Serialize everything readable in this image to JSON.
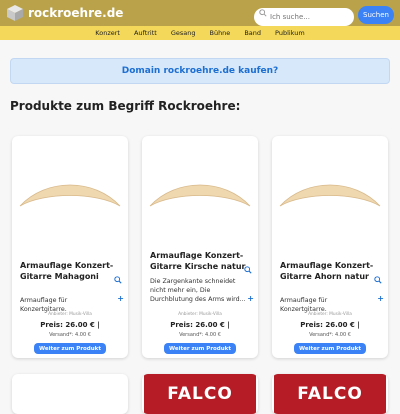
{
  "site": {
    "name": "rockroehre.de"
  },
  "search": {
    "placeholder": "Ich suche...",
    "button_label": "Suchen"
  },
  "nav": {
    "items": [
      "Konzert",
      "Auftritt",
      "Gesang",
      "Bühne",
      "Band",
      "Publikum"
    ]
  },
  "banner": {
    "text": "Domain rockroehre.de kaufen?"
  },
  "section": {
    "title": "Produkte zum Begriff Rockroehre:"
  },
  "products": [
    {
      "title": "Armauflage Konzert-Gitarre Mahagoni",
      "description": "Armauflage für Konzertgitarre.",
      "seller": "Anbieter: Musik-Villa",
      "price": "Preis: 26.00 € |",
      "shipping": "Versand*: 4.00 €",
      "button": "Weiter zum Produkt"
    },
    {
      "title": "Armauflage Konzert-Gitarre Kirsche natur",
      "description": "Die Zargenkante schneidet nicht mehr ein, Die Durchblutung des Arms wird...",
      "seller": "Anbieter: Musik-Villa",
      "price": "Preis: 26.00 € |",
      "shipping": "Versand*: 4.00 €",
      "button": "Weiter zum Produkt"
    },
    {
      "title": "Armauflage Konzert-Gitarre Ahorn natur",
      "description": "Armauflage für Konzertgitarre.",
      "seller": "Anbieter: Musik-Villa",
      "price": "Preis: 26.00 € |",
      "shipping": "Versand*: 4.00 €",
      "button": "Weiter zum Produkt"
    }
  ],
  "next_row": {
    "logo_text": "FALCO"
  },
  "colors": {
    "header": "#b9a24a",
    "nav": "#f4d85a",
    "accent": "#3b82f6",
    "banner": "#d7e8fb",
    "falco_red": "#b51c25"
  }
}
